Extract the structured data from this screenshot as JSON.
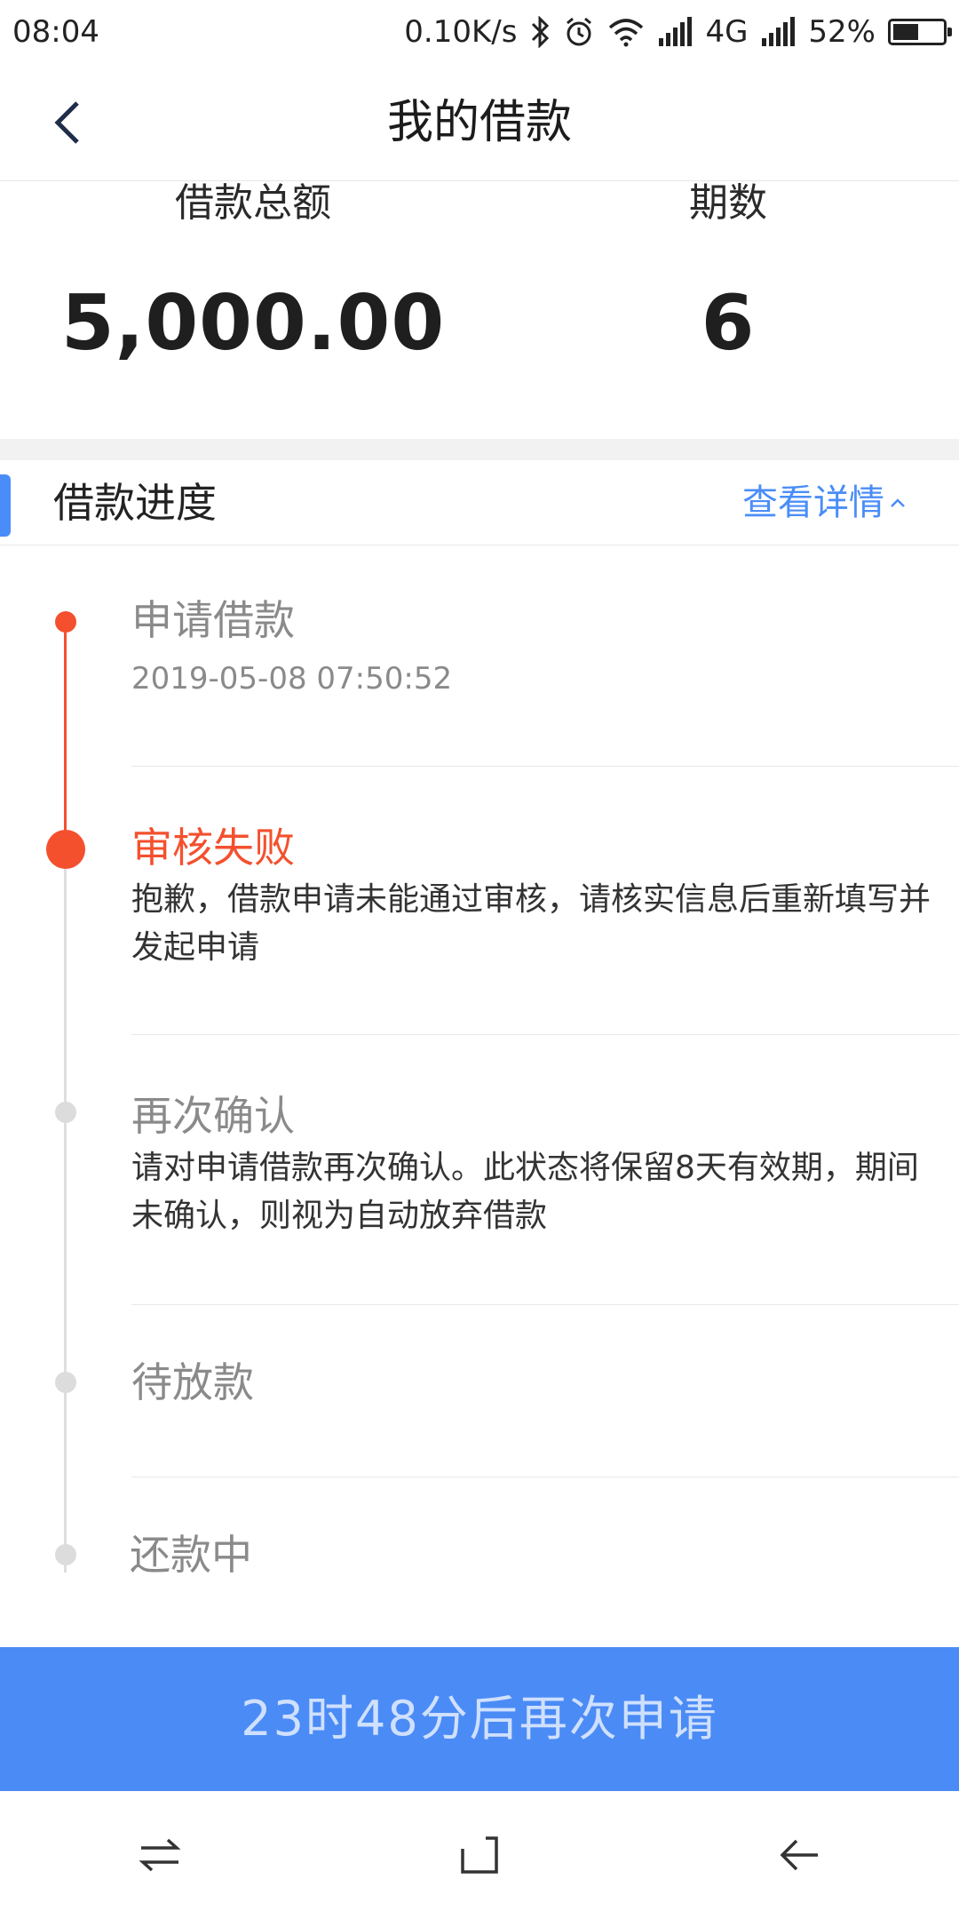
{
  "status_bar": {
    "time": "08:04",
    "speed": "0.10K/s",
    "network": "4G",
    "battery_percent": "52%",
    "battery_level": 0.52,
    "icons": [
      "bluetooth-icon",
      "alarm-icon",
      "wifi-icon",
      "signal-icon",
      "signal-icon",
      "battery-icon"
    ]
  },
  "header": {
    "title": "我的借款",
    "back_icon": "chevron-left-icon"
  },
  "summary": {
    "amount_label": "借款总额",
    "amount_value": "5,000.00",
    "periods_label": "期数",
    "periods_value": "6"
  },
  "progress": {
    "title": "借款进度",
    "detail_link": "查看详情",
    "detail_icon": "chevron-up-icon",
    "steps": [
      {
        "title": "申请借款",
        "time": "2019-05-08 07:50:52",
        "state": "done"
      },
      {
        "title": "审核失败",
        "desc": "抱歉，借款申请未能通过审核，请核实信息后重新填写并发起申请",
        "state": "current"
      },
      {
        "title": "再次确认",
        "desc": "请对申请借款再次确认。此状态将保留8天有效期，期间未确认，则视为自动放弃借款",
        "state": "pending"
      },
      {
        "title": "待放款",
        "state": "pending"
      },
      {
        "title": "还款中",
        "state": "pending"
      }
    ]
  },
  "action": {
    "label": "23时48分后再次申请"
  },
  "colors": {
    "accent": "#4a8df8",
    "error": "#f4502e",
    "pending": "#dcdcdc"
  },
  "system_nav": [
    "switch-icon",
    "home-icon",
    "back-icon"
  ]
}
